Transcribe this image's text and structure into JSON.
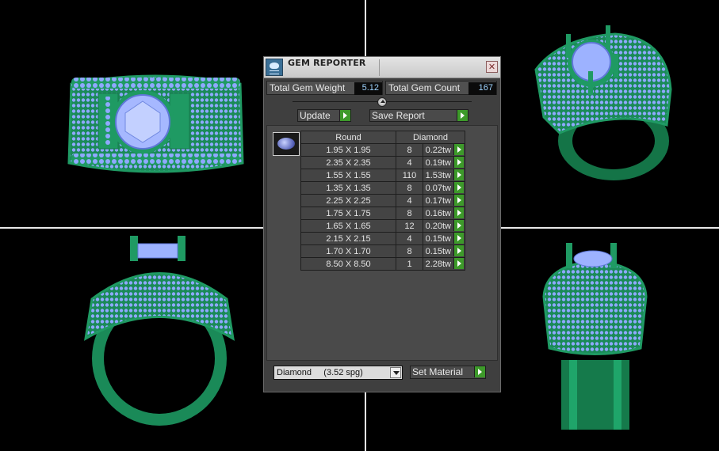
{
  "window": {
    "title": "GEM REPORTER",
    "close_glyph": "✕",
    "icon": "gem-reporter-icon"
  },
  "stats": {
    "weight_label": "Total Gem Weight",
    "weight_value": "5.12",
    "count_label": "Total Gem Count",
    "count_value": "167"
  },
  "buttons": {
    "update": "Update",
    "save_report": "Save Report",
    "set_material": "Set Material"
  },
  "table": {
    "headers": {
      "shape": "Round",
      "material": "Diamond"
    },
    "rows": [
      {
        "size": "1.95 X 1.95",
        "count": "8",
        "weight": "0.22tw"
      },
      {
        "size": "2.35 X 2.35",
        "count": "4",
        "weight": "0.19tw"
      },
      {
        "size": "1.55 X 1.55",
        "count": "110",
        "weight": "1.53tw"
      },
      {
        "size": "1.35 X 1.35",
        "count": "8",
        "weight": "0.07tw"
      },
      {
        "size": "2.25 X 2.25",
        "count": "4",
        "weight": "0.17tw"
      },
      {
        "size": "1.75 X 1.75",
        "count": "8",
        "weight": "0.16tw"
      },
      {
        "size": "1.65 X 1.65",
        "count": "12",
        "weight": "0.20tw"
      },
      {
        "size": "2.15 X 2.15",
        "count": "4",
        "weight": "0.15tw"
      },
      {
        "size": "1.70 X 1.70",
        "count": "8",
        "weight": "0.15tw"
      },
      {
        "size": "8.50 X 8.50",
        "count": "1",
        "weight": "2.28tw"
      }
    ]
  },
  "material_select": {
    "value": "Diamond     (3.52 spg)"
  },
  "colors": {
    "metal": "#1f9a63",
    "gem": "#8fa9ff",
    "background": "#000000",
    "panel": "#3f3f3f",
    "go_button": "#3d9a2a"
  }
}
